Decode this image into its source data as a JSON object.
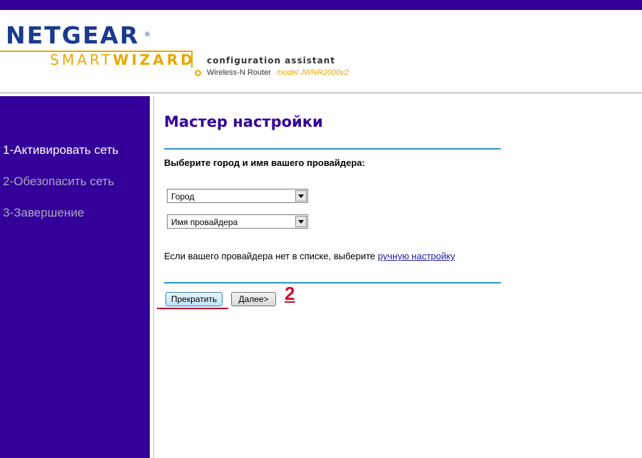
{
  "header": {
    "brand": "NETGEAR",
    "registered_mark": "®",
    "smart": "SMART",
    "wizard": "WIZARD",
    "subtitle": "configuration assistant",
    "product": "Wireless-N Router",
    "model": "model JWNR2000v2"
  },
  "sidebar": {
    "steps": [
      {
        "label": "1-Активировать сеть",
        "active": true
      },
      {
        "label": "2-Обезопасить сеть",
        "active": false
      },
      {
        "label": "3-Завершение",
        "active": false
      }
    ]
  },
  "main": {
    "title": "Мастер настройки",
    "prompt": "Выберите город и имя вашего провайдера:",
    "city_select": {
      "value": "Город"
    },
    "provider_select": {
      "value": "Имя провайдера"
    },
    "hint_text": "Если вашего провайдера нет в списке, выберите ",
    "hint_link": "ручную настройку",
    "cancel_label": "Прекратить",
    "next_label": "Далее>",
    "annotation_number": "2"
  },
  "colors": {
    "sidebar": "#330099",
    "title": "#330099",
    "rule": "#2a9ad0",
    "annotation": "#c8102e",
    "logo_gold": "#e8a800"
  }
}
